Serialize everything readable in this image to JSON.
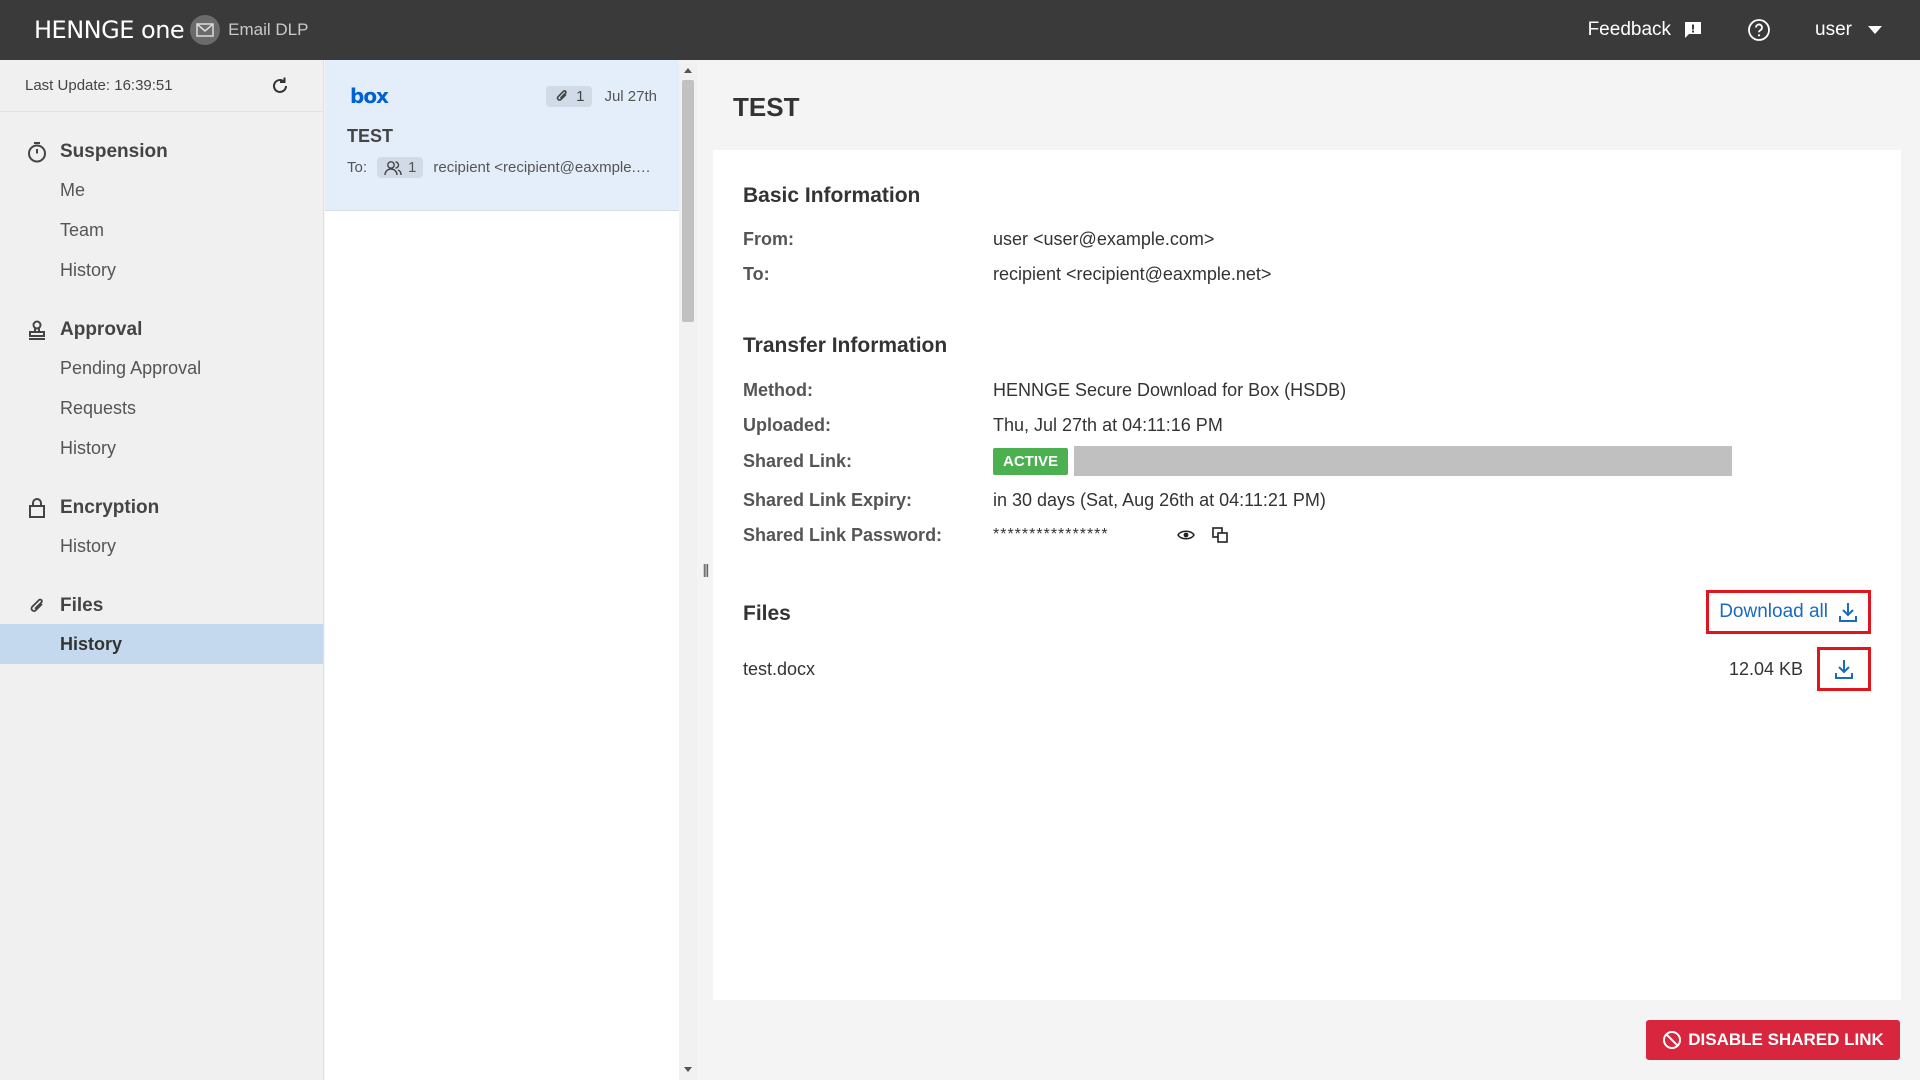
{
  "header": {
    "brand": "HENNGE one",
    "product": "Email DLP",
    "feedback_label": "Feedback",
    "user_label": "user"
  },
  "sidebar": {
    "last_update": "Last Update: 16:39:51",
    "sections": [
      {
        "title": "Suspension",
        "icon": "stopwatch-icon",
        "items": [
          "Me",
          "Team",
          "History"
        ]
      },
      {
        "title": "Approval",
        "icon": "stamp-icon",
        "items": [
          "Pending Approval",
          "Requests",
          "History"
        ]
      },
      {
        "title": "Encryption",
        "icon": "lock-icon",
        "items": [
          "History"
        ]
      },
      {
        "title": "Files",
        "icon": "paperclip-icon",
        "items": [
          "History"
        ],
        "active_item": "History"
      }
    ]
  },
  "list": {
    "items": [
      {
        "service": "box",
        "attachments": "1",
        "date": "Jul 27th",
        "subject": "TEST",
        "to_label": "To:",
        "recipient_count": "1",
        "recipients": "recipient <recipient@eaxmple.net>"
      }
    ]
  },
  "detail": {
    "title": "TEST",
    "basic": {
      "title": "Basic Information",
      "from_label": "From:",
      "from_value": "user <user@example.com>",
      "to_label": "To:",
      "to_value": "recipient <recipient@eaxmple.net>"
    },
    "transfer": {
      "title": "Transfer Information",
      "method_label": "Method:",
      "method_value": "HENNGE Secure Download for Box (HSDB)",
      "uploaded_label": "Uploaded:",
      "uploaded_value": "Thu, Jul 27th at 04:11:16 PM",
      "link_label": "Shared Link:",
      "link_status": "ACTIVE",
      "expiry_label": "Shared Link Expiry:",
      "expiry_value": "in 30 days (Sat, Aug 26th at 04:11:21 PM)",
      "password_label": "Shared Link Password:",
      "password_value": "****************"
    },
    "files": {
      "title": "Files",
      "download_all_label": "Download all",
      "items": [
        {
          "name": "test.docx",
          "size": "12.04 KB"
        }
      ]
    },
    "disable_label": "DISABLE SHARED LINK"
  },
  "colors": {
    "topbar": "#3a3a3a",
    "active_nav": "#c5d9ee",
    "selected_card": "#e3eefa",
    "active_badge": "#4caf50",
    "link": "#1a6ac0",
    "highlight_border": "#e0151e",
    "danger": "#d7263d"
  }
}
